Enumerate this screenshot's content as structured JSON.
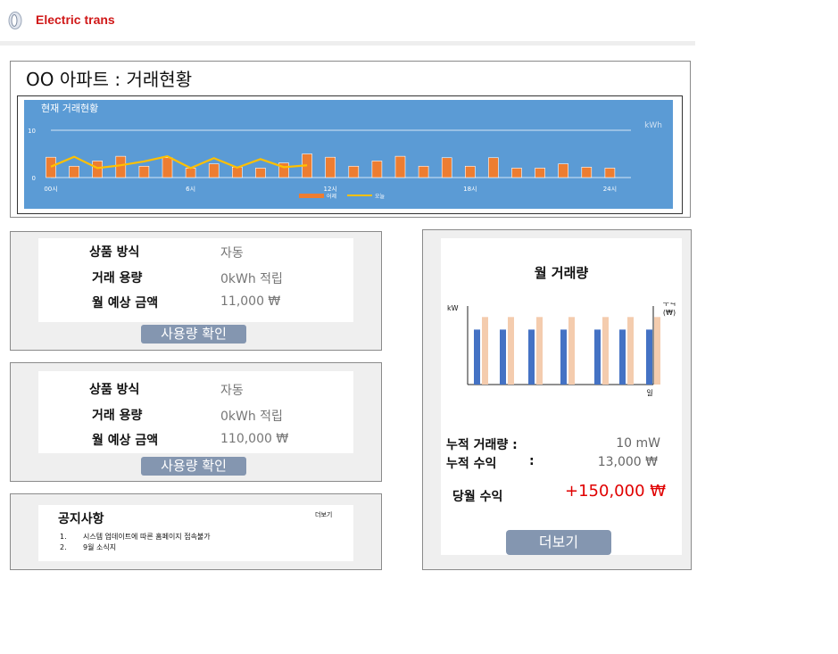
{
  "app": {
    "title": "Electric trans"
  },
  "page": {
    "title": "OO 아파트 : 거래현황"
  },
  "chart_data": [
    {
      "type": "bar",
      "title": "현재 거래현황",
      "unit_label": "kWh",
      "xlabel": "",
      "ylabel": "",
      "ylim": [
        0,
        10
      ],
      "yticks": [
        "10",
        "0"
      ],
      "xtick_labels": [
        "00시",
        "6시",
        "12시",
        "18시",
        "24시"
      ],
      "categories": [
        "0",
        "1",
        "2",
        "3",
        "4",
        "5",
        "6",
        "7",
        "8",
        "9",
        "10",
        "11",
        "12",
        "13",
        "14",
        "15",
        "16",
        "17",
        "18",
        "19",
        "20",
        "21",
        "22",
        "23",
        "24"
      ],
      "series": [
        {
          "name": "어제",
          "type": "bar",
          "values": [
            4.3,
            2.4,
            3.5,
            4.5,
            2.4,
            4.2,
            2.0,
            2.9,
            2.2,
            2.0,
            3.1,
            5.0,
            4.3,
            2.4,
            3.5,
            4.5,
            2.4,
            4.2,
            2.4,
            4.2,
            2.0,
            2.0,
            2.9,
            2.2,
            2.0
          ]
        },
        {
          "name": "오늘",
          "type": "line",
          "values": [
            2.3,
            4.4,
            2.0,
            2.6,
            3.4,
            4.5,
            2.0,
            4.1,
            2.1,
            3.9,
            2.2,
            2.6
          ]
        }
      ],
      "legend": "bottom-center"
    },
    {
      "type": "bar",
      "title": "월 거래량",
      "ylabel_left": "kW",
      "ylabel_right": "수익\n(₩)",
      "xlabel": "일",
      "series": [
        {
          "name": "",
          "values": [
            3.5,
            3.5,
            3.5,
            3.5,
            3.5,
            3.5,
            3.5
          ]
        },
        {
          "name": "",
          "values": [
            4.3,
            4.3,
            4.3,
            4.3,
            4.3,
            4.3,
            4.3
          ]
        }
      ],
      "colors": {
        "kw": "#4472c4",
        "revenue": "#f4ccae"
      }
    }
  ],
  "cards": [
    {
      "rows": [
        {
          "label": "상품 방식",
          "value": "자동"
        },
        {
          "label": "거래 용량",
          "value": "0kWh 적립"
        },
        {
          "label": "월 예상 금액",
          "value": "11,000 ₩"
        }
      ],
      "button": "사용량 확인"
    },
    {
      "rows": [
        {
          "label": "상품 방식",
          "value": "자동"
        },
        {
          "label": "거래 용량",
          "value": "0kWh 적립"
        },
        {
          "label": "월 예상 금액",
          "value": "110,000 ₩"
        }
      ],
      "button": "사용량 확인"
    }
  ],
  "notice": {
    "title": "공지사항",
    "more": "더보기",
    "items": [
      {
        "num": "1.",
        "text": "시스템 업데이트에 따른 홈페이지 접속불가"
      },
      {
        "num": "2.",
        "text": "9월 소식지"
      }
    ]
  },
  "summary": {
    "title": "월 거래량",
    "cumulative_volume_label": "누적 거래량 :",
    "cumulative_volume_value": "10 mW",
    "cumulative_revenue_label": "누적 수익",
    "cumulative_revenue_colon": ":",
    "cumulative_revenue_value": "13,000 ₩",
    "monthly_revenue_label": "당월 수익",
    "monthly_revenue_value": "+150,000 ₩",
    "more_button": "더보기"
  },
  "colors": {
    "brand": "#d01818",
    "chart_bg": "#5b9bd5",
    "bar_yesterday": "#ed7d31",
    "line_today": "#ffc000",
    "button": "#8496b0",
    "revenue_positive": "#e00000"
  }
}
